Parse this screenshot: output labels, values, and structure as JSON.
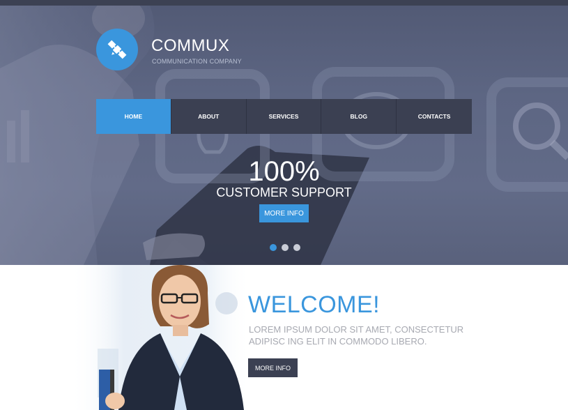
{
  "brand": {
    "name": "COMMUX",
    "tagline": "COMMUNICATION COMPANY",
    "logo_icon": "satellite-icon"
  },
  "nav": {
    "items": [
      {
        "label": "HOME",
        "active": true
      },
      {
        "label": "ABOUT",
        "active": false
      },
      {
        "label": "SERVICES",
        "active": false
      },
      {
        "label": "BLOG",
        "active": false
      },
      {
        "label": "CONTACTS",
        "active": false
      }
    ]
  },
  "hero": {
    "big_text": "100%",
    "sub_text": "CUSTOMER SUPPORT",
    "button_label": "MORE INFO",
    "slides_count": 3,
    "active_slide": 1
  },
  "welcome": {
    "title": "WELCOME!",
    "text": "LOREM IPSUM DOLOR SIT AMET, CONSECTETUR ADIPISC ING ELIT IN COMMODO LIBERO.",
    "button_label": "MORE INFO"
  },
  "colors": {
    "accent": "#3a96dd",
    "dark": "#3b4052",
    "text_gray": "#a7a9b1"
  }
}
